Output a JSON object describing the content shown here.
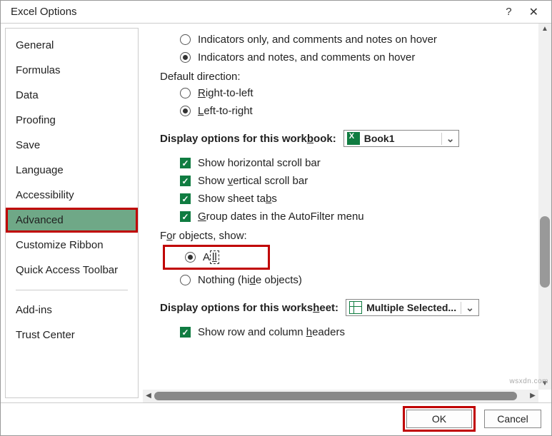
{
  "window": {
    "title": "Excel Options",
    "help": "?",
    "close": "✕"
  },
  "sidebar": {
    "items": [
      {
        "label": "General"
      },
      {
        "label": "Formulas"
      },
      {
        "label": "Data"
      },
      {
        "label": "Proofing"
      },
      {
        "label": "Save"
      },
      {
        "label": "Language"
      },
      {
        "label": "Accessibility"
      },
      {
        "label": "Advanced",
        "selected": true
      },
      {
        "label": "Customize Ribbon"
      },
      {
        "label": "Quick Access Toolbar"
      },
      {
        "label": "Add-ins"
      },
      {
        "label": "Trust Center"
      }
    ]
  },
  "main": {
    "comments": {
      "opt1": "Indicators only, and comments and notes on hover",
      "opt2": "Indicators and notes, and comments on hover",
      "selected": "opt2"
    },
    "default_direction": {
      "label": "Default direction:",
      "rtl_pre": "",
      "rtl_u": "R",
      "rtl_post": "ight-to-left",
      "ltr_pre": "",
      "ltr_u": "L",
      "ltr_post": "eft-to-right",
      "selected": "ltr"
    },
    "workbook": {
      "heading_pre": "Display options for this work",
      "heading_u": "b",
      "heading_post": "ook:",
      "selected": "Book1",
      "hscroll": "Show horizontal scroll bar",
      "vscroll_pre": "Show ",
      "vscroll_u": "v",
      "vscroll_post": "ertical scroll bar",
      "tabs_pre": "Show sheet ta",
      "tabs_u": "b",
      "tabs_post": "s",
      "group_pre": "",
      "group_u": "G",
      "group_post": "roup dates in the AutoFilter menu",
      "hscroll_checked": true,
      "vscroll_checked": true,
      "tabs_checked": true,
      "group_checked": true
    },
    "objects": {
      "heading_pre": "F",
      "heading_u": "o",
      "heading_post": "r objects, show:",
      "all_pre": "A",
      "all_u": "ll",
      "all_post": "",
      "nothing_pre": "Nothing (hi",
      "nothing_u": "d",
      "nothing_post": "e objects)",
      "selected": "all"
    },
    "worksheet": {
      "heading_pre": "Display options for this works",
      "heading_u": "h",
      "heading_post": "eet:",
      "selected": "Multiple Selected...",
      "headers_pre": "Show row and column ",
      "headers_u": "h",
      "headers_post": "eaders",
      "headers_checked": true
    }
  },
  "footer": {
    "ok": "OK",
    "cancel": "Cancel"
  },
  "watermark": "wsxdn.com"
}
